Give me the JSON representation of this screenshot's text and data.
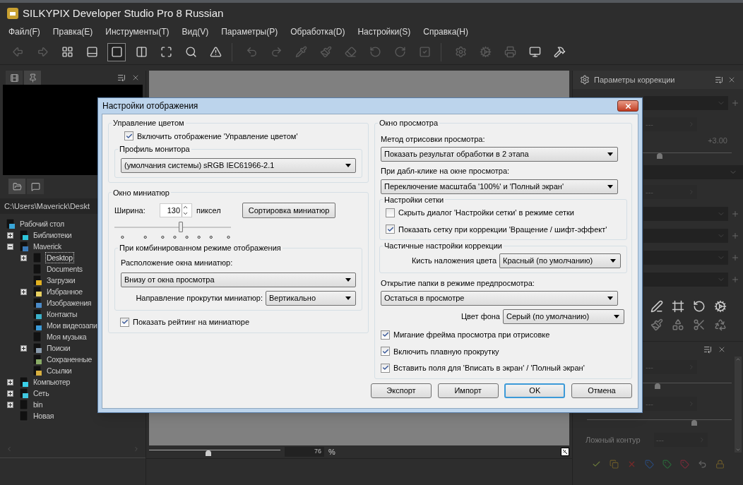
{
  "window": {
    "title": "SILKYPIX Developer Studio Pro 8 Russian"
  },
  "menu": [
    "Файл(F)",
    "Правка(E)",
    "Инструменты(T)",
    "Вид(V)",
    "Параметры(P)",
    "Обработка(D)",
    "Настройки(S)",
    "Справка(H)"
  ],
  "toolbar": [
    [
      {
        "kind": "back",
        "disabled": true,
        "selected": false
      },
      {
        "kind": "forward",
        "disabled": true,
        "selected": false
      },
      {
        "kind": "grid",
        "disabled": false,
        "selected": false
      },
      {
        "kind": "thumbs",
        "disabled": false,
        "selected": false
      },
      {
        "kind": "single",
        "disabled": false,
        "selected": true
      },
      {
        "kind": "compare",
        "disabled": false,
        "selected": false
      },
      {
        "kind": "fullscreen",
        "disabled": false,
        "selected": false
      },
      {
        "kind": "zoom",
        "disabled": false,
        "selected": false
      },
      {
        "kind": "warning",
        "disabled": false,
        "selected": false
      }
    ],
    [
      {
        "kind": "undo",
        "disabled": true,
        "selected": false
      },
      {
        "kind": "redo",
        "disabled": true,
        "selected": false
      },
      {
        "kind": "pipette",
        "disabled": true,
        "selected": false
      },
      {
        "kind": "brush",
        "disabled": true,
        "selected": false
      },
      {
        "kind": "eraser",
        "disabled": true,
        "selected": false
      },
      {
        "kind": "rotate-left",
        "disabled": true,
        "selected": false
      },
      {
        "kind": "rotate-right",
        "disabled": true,
        "selected": false
      },
      {
        "kind": "check",
        "disabled": true,
        "selected": false
      }
    ],
    [
      {
        "kind": "settings",
        "disabled": true,
        "selected": false
      },
      {
        "kind": "settings2",
        "disabled": true,
        "selected": false
      },
      {
        "kind": "printer",
        "disabled": true,
        "selected": false
      },
      {
        "kind": "monitor",
        "disabled": false,
        "selected": false
      },
      {
        "kind": "hammer",
        "disabled": false,
        "selected": false
      }
    ]
  ],
  "left_panel": {
    "top_tabs": [
      {
        "kind": "frames",
        "selected": false
      },
      {
        "kind": "pin",
        "selected": true
      }
    ],
    "bottom_tabs": [
      {
        "kind": "folder",
        "selected": true
      },
      {
        "kind": "comment",
        "selected": false
      }
    ],
    "path": "C:\\Users\\Maverick\\Deskt",
    "tree": [
      {
        "label": "Рабочий стол",
        "kind": "desktop",
        "selected": false,
        "children": [
          {
            "label": "Библиотеки",
            "kind": "library",
            "expanded": false,
            "selected": false
          },
          {
            "label": "Maverick",
            "kind": "user",
            "expanded": true,
            "selected": false,
            "children": [
              {
                "label": "Desktop",
                "kind": "folder",
                "expanded": false,
                "selected": true
              },
              {
                "label": "Documents",
                "kind": "folder",
                "selected": false
              },
              {
                "label": "Загрузки",
                "kind": "download",
                "selected": false
              },
              {
                "label": "Избранное",
                "kind": "star",
                "expanded": false,
                "selected": false
              },
              {
                "label": "Изображения",
                "kind": "image",
                "selected": false
              },
              {
                "label": "Контакты",
                "kind": "contacts",
                "selected": false
              },
              {
                "label": "Мои видеозапи",
                "kind": "video",
                "selected": false
              },
              {
                "label": "Моя музыка",
                "kind": "folder",
                "selected": false
              },
              {
                "label": "Поиски",
                "kind": "search",
                "expanded": false,
                "selected": false
              },
              {
                "label": "Сохраненные",
                "kind": "saved",
                "selected": false
              },
              {
                "label": "Ссылки",
                "kind": "links",
                "selected": false
              }
            ]
          },
          {
            "label": "Компьютер",
            "kind": "computer",
            "expanded": false,
            "selected": false
          },
          {
            "label": "Сеть",
            "kind": "network",
            "expanded": false,
            "selected": false
          },
          {
            "label": "bin",
            "kind": "folder",
            "expanded": false,
            "selected": false
          },
          {
            "label": "Новая",
            "kind": "folder",
            "selected": false
          }
        ]
      }
    ]
  },
  "viewer": {
    "zoom_value": "76",
    "zoom_unit": "%",
    "zoom_slider": {
      "level": 0.45
    }
  },
  "right_panel": {
    "title": "Параметры коррекции",
    "rows": [
      {
        "kind": "dropdown"
      },
      {
        "kind": "field",
        "value": "---"
      },
      {
        "kind": "reading",
        "value": "+3.00"
      },
      {
        "kind": "slider",
        "level": 0.5
      },
      {
        "kind": "section"
      },
      {
        "kind": "field",
        "value": "---"
      },
      {
        "kind": "dropdown"
      },
      {
        "kind": "dropdown"
      },
      {
        "kind": "dropdown"
      },
      {
        "kind": "dropdown"
      }
    ],
    "tools": [
      [
        {
          "kind": "pen"
        },
        {
          "kind": "frame"
        },
        {
          "kind": "rotate"
        },
        {
          "kind": "gears"
        }
      ],
      [
        {
          "kind": "brush"
        },
        {
          "kind": "shapes"
        },
        {
          "kind": "scissors"
        },
        {
          "kind": "recycle"
        }
      ]
    ],
    "second_rows": [
      {
        "kind": "field",
        "value": "---"
      },
      {
        "kind": "slider",
        "level": 0.49
      },
      {
        "kind": "field",
        "value": "---"
      },
      {
        "kind": "slider",
        "level": 0.74
      },
      {
        "kind": "labeled",
        "label": "Ложный контур",
        "value": "---"
      }
    ],
    "bottom_tools": [
      {
        "kind": "check"
      },
      {
        "kind": "copy"
      },
      {
        "kind": "delete"
      },
      {
        "kind": "tag-blue"
      },
      {
        "kind": "tag-green"
      },
      {
        "kind": "tag-red"
      },
      {
        "kind": "undo"
      },
      {
        "kind": "lock"
      }
    ]
  },
  "dialog": {
    "title": "Настройки отображения",
    "color_management": {
      "title": "Управление цветом",
      "enable": {
        "label": "Включить отображение 'Управление цветом'",
        "checked": true
      },
      "profile_title": "Профиль монитора",
      "profile_value": "(умолчания системы) sRGB IEC61966-2.1"
    },
    "thumbnails": {
      "title": "Окно миниатюр",
      "width_label": "Ширина:",
      "width_value": "130",
      "unit": "пиксел",
      "sort_button": "Сортировка миниатюр",
      "size_slider": {
        "level": 0.57
      },
      "combined_title": "При комбинированном режиме отображения",
      "position_label": "Расположение окна миниатюр:",
      "position_value": "Внизу от окна просмотра",
      "scroll_label": "Направление прокрутки миниатюр:",
      "scroll_value": "Вертикально"
    },
    "show_rating": {
      "label": "Показать рейтинг на миниатюре",
      "checked": true
    },
    "preview": {
      "title": "Окно просмотра",
      "render_label": "Метод отрисовки просмотра:",
      "render_value": "Показать результат обработки в 2 этапа",
      "dblclick_label": "При дабл-клике на окне просмотра:",
      "dblclick_value": "Переключение масштаба '100%' и 'Полный экран'",
      "grid_title": "Настройки сетки",
      "grid_options": [
        {
          "label": "Скрыть диалог 'Настройки сетки' в режиме сетки",
          "checked": false
        },
        {
          "label": "Показать сетку при коррекции 'Вращение / шифт-эффект'",
          "checked": true
        }
      ],
      "partial_title": "Частичные настройки коррекции",
      "brush_label": "Кисть наложения цвета",
      "brush_value": "Красный (по умолчанию)",
      "open_label": "Открытие папки в режиме предпросмотра:",
      "open_value": "Остаться в просмотре",
      "bg_label": "Цвет фона",
      "bg_value": "Серый (по умолчанию)",
      "options": [
        {
          "label": "Мигание фрейма просмотра при отрисовке",
          "checked": true
        },
        {
          "label": "Включить плавную прокрутку",
          "checked": true
        },
        {
          "label": "Вставить поля для 'Вписать в экран' / 'Полный экран'",
          "checked": true
        }
      ]
    },
    "buttons": [
      {
        "label": "Экспорт",
        "default": false
      },
      {
        "label": "Импорт",
        "default": false
      },
      {
        "label": "OK",
        "default": true
      },
      {
        "label": "Отмена",
        "default": false
      }
    ]
  }
}
